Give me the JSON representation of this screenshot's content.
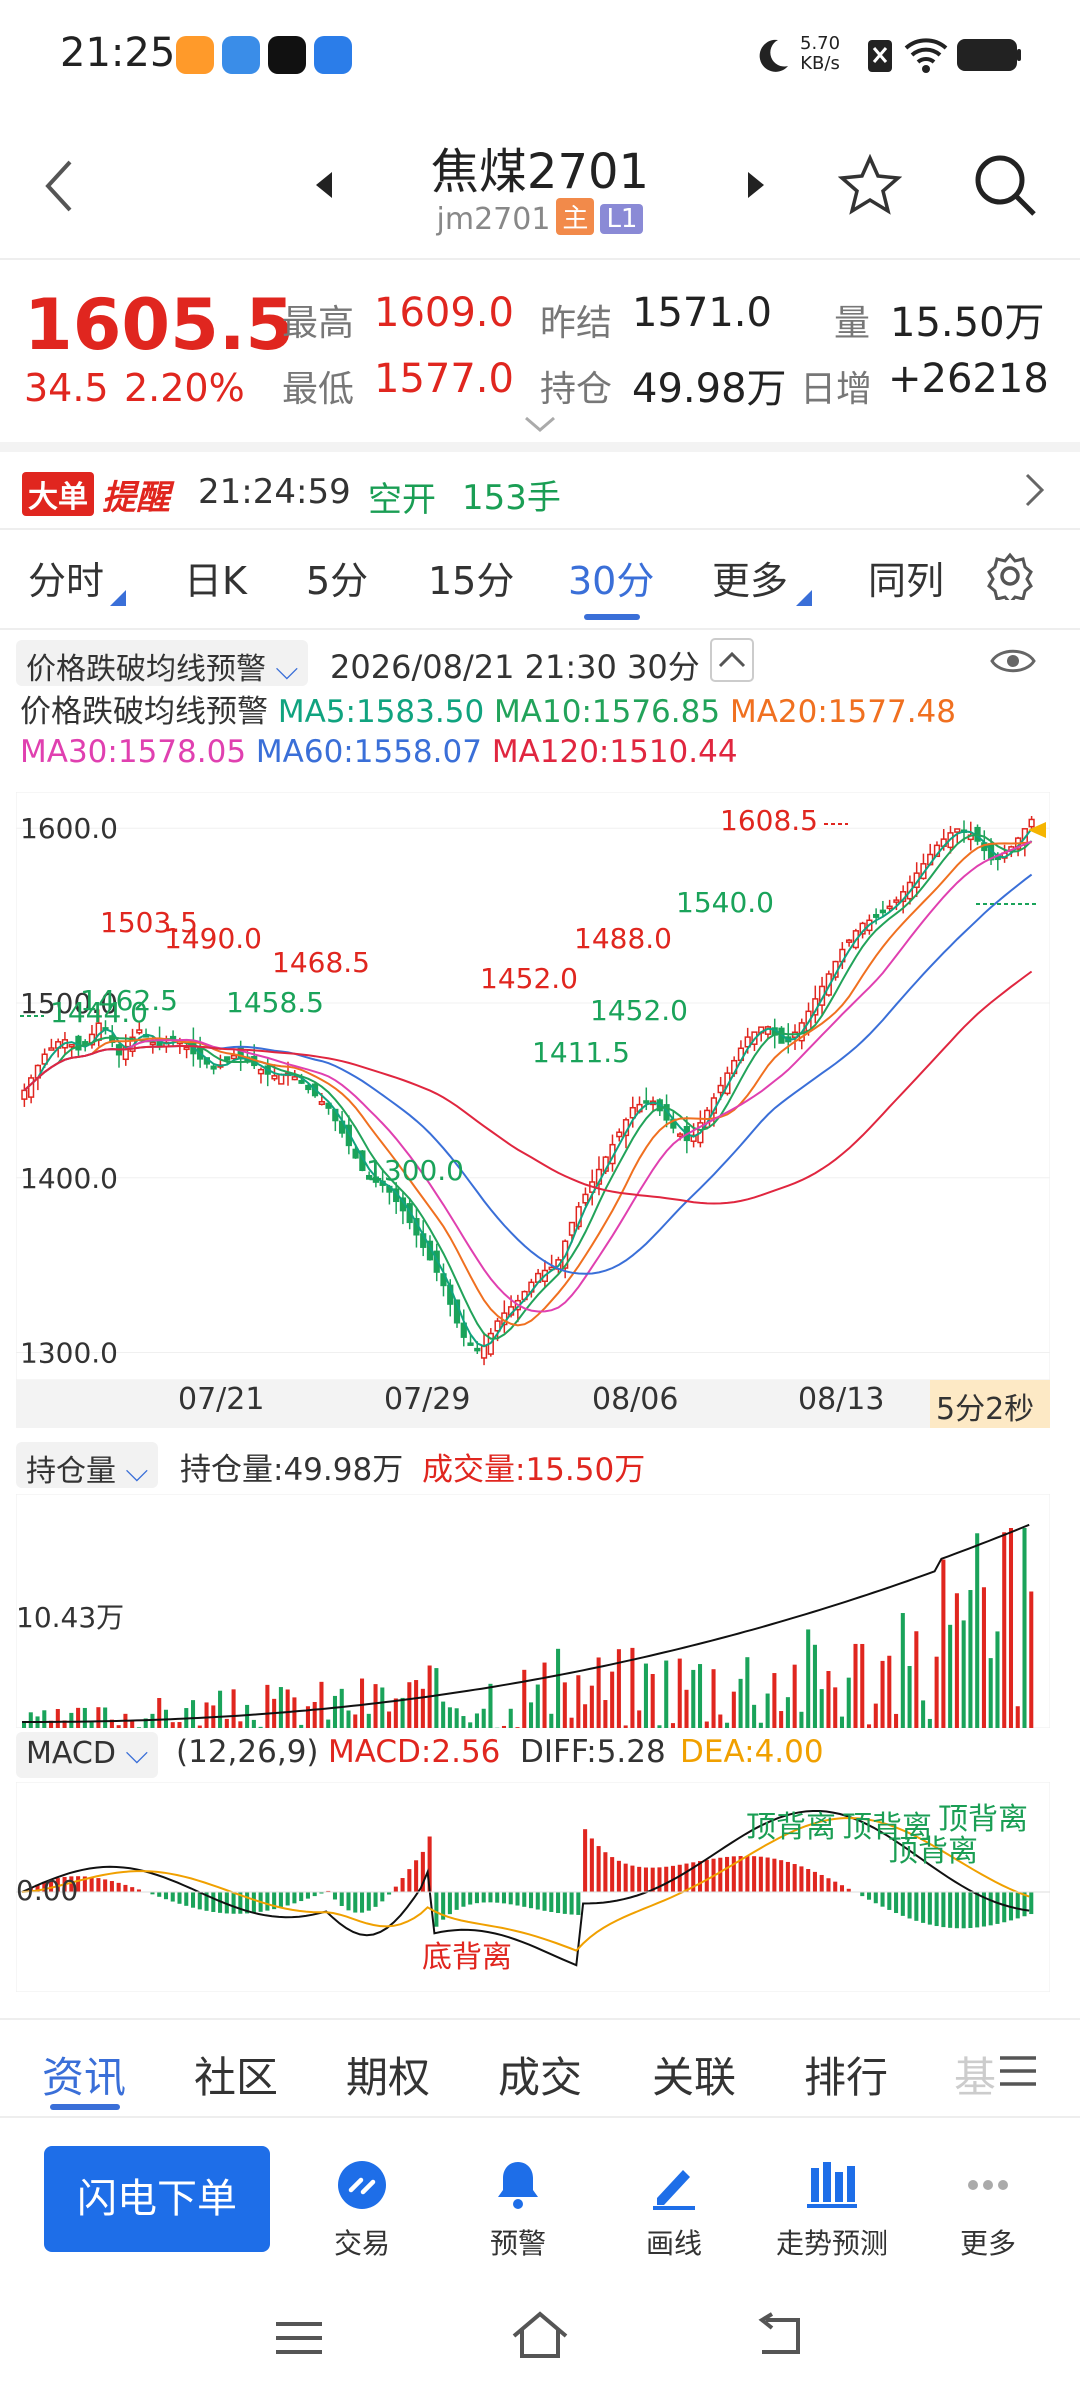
{
  "status_bar": {
    "time": "21:25",
    "net_speed_value": "5.70",
    "net_speed_unit": "KB/s"
  },
  "header": {
    "title": "焦煤2701",
    "code": "jm2701",
    "tag_main": "主",
    "tag_level": "L1"
  },
  "quote": {
    "last": "1605.5",
    "change": "34.5",
    "change_pct": "2.20%",
    "high_label": "最高",
    "high": "1609.0",
    "low_label": "最低",
    "low": "1577.0",
    "prev_settle_label": "昨结",
    "prev_settle": "1571.0",
    "open_interest_label": "持仓",
    "open_interest": "49.98万",
    "volume_label": "量",
    "volume": "15.50万",
    "daily_increase_label": "日增",
    "daily_increase": "+26218"
  },
  "alert": {
    "badge1": "大单",
    "badge2": "提醒",
    "time": "21:24:59",
    "type": "空开",
    "qty": "153手"
  },
  "periods": {
    "items": [
      "分时",
      "日K",
      "5分",
      "15分",
      "30分",
      "更多",
      "同列"
    ],
    "active": "30分"
  },
  "kline": {
    "indicator_select": "价格跌破均线预警",
    "datetime": "2026/08/21 21:30  30分",
    "indicator_title": "价格跌破均线预警",
    "ma5": "MA5:1583.50",
    "ma10": "MA10:1576.85",
    "ma20": "MA20:1577.48",
    "ma30": "MA30:1578.05",
    "ma60": "MA60:1558.07",
    "ma120": "MA120:1510.44",
    "countdown": "5分2秒",
    "oi_select": "持仓量",
    "oi_text": "持仓量:49.98万",
    "vol_text": "成交量:15.50万",
    "vol_axis_label": "10.43万",
    "macd_select": "MACD",
    "macd_params": "(12,26,9)",
    "macd_val": "MACD:2.56",
    "diff_val": "DIFF:5.28",
    "dea_val": "DEA:4.00",
    "macd_zero": "0.00",
    "div_top": [
      "顶背离",
      "顶背离",
      "顶背离",
      "顶背离"
    ],
    "div_bottom": "底背离",
    "colors": {
      "ma5": "#10a37f",
      "ma10": "#22a35a",
      "ma20": "#f07020",
      "ma30": "#e040b0",
      "ma60": "#3a6fd8",
      "ma120": "#e0263f",
      "up": "#e0261f",
      "down": "#1aa35a"
    }
  },
  "chart_data": {
    "type": "candlestick",
    "y_ticks": [
      "1600.0",
      "1500.0",
      "1400.0",
      "1300.0"
    ],
    "ylim": [
      1290,
      1615
    ],
    "x_ticks": [
      "07/21",
      "07/29",
      "08/06",
      "08/13"
    ],
    "annotations": [
      "1503.5",
      "1490.0",
      "1468.5",
      "1462.5",
      "1458.5",
      "1444.0",
      "1300.0",
      "1452.0",
      "1488.0",
      "1452.0",
      "1411.5",
      "1608.5",
      "1540.0"
    ],
    "close_path": [
      1450,
      1470,
      1480,
      1472,
      1490,
      1470,
      1485,
      1475,
      1480,
      1470,
      1462,
      1470,
      1465,
      1458,
      1460,
      1450,
      1440,
      1420,
      1400,
      1395,
      1380,
      1360,
      1340,
      1310,
      1300,
      1320,
      1330,
      1345,
      1350,
      1380,
      1400,
      1420,
      1440,
      1445,
      1430,
      1420,
      1440,
      1460,
      1480,
      1488,
      1475,
      1490,
      1510,
      1530,
      1545,
      1550,
      1560,
      1575,
      1590,
      1600,
      1595,
      1580,
      1590,
      1605
    ]
  },
  "tabs": {
    "items": [
      "资讯",
      "社区",
      "期权",
      "成交",
      "关联",
      "排行",
      "基"
    ],
    "active": "资讯"
  },
  "actions": {
    "primary": "闪电下单",
    "items": [
      "交易",
      "预警",
      "画线",
      "走势预测",
      "更多"
    ]
  }
}
